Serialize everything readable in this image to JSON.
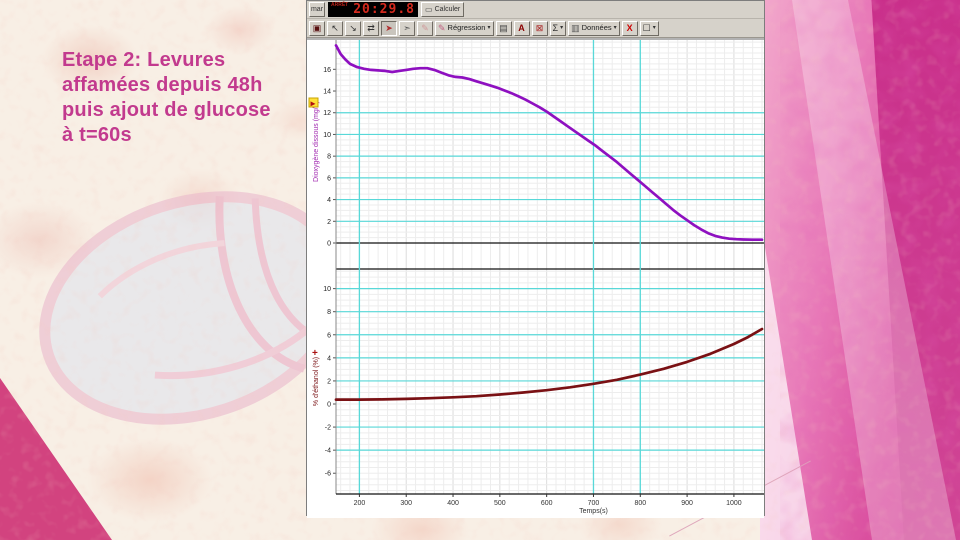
{
  "slide": {
    "title_lines": [
      "Etape 2: Levures",
      "affamées depuis 48h",
      "puis ajout de glucose",
      "à t=60s"
    ],
    "title_color": "#c23a8e"
  },
  "app": {
    "run_button_label": "mar",
    "timer": {
      "status": "ARRÊT",
      "value": "20:29.8"
    },
    "calculate_button": "Calculer",
    "icons": {
      "calculate": "▭",
      "caret": "▾"
    },
    "toolbar": [
      {
        "name": "graph-window-button",
        "glyph": "▣",
        "color": "#5a1111"
      },
      {
        "name": "cursor-zoom-in-button",
        "glyph": "↖"
      },
      {
        "name": "cursor-zoom-out-button",
        "glyph": "↘"
      },
      {
        "name": "swap-curves-button",
        "glyph": "⇄"
      },
      {
        "name": "pointer-tool-button",
        "glyph": "➤",
        "color": "#b03030",
        "pressed": true
      },
      {
        "name": "pointer-menu-button",
        "glyph": "➣",
        "color": "#555"
      },
      {
        "name": "pencil-tool-button",
        "glyph": "✎",
        "muted": true
      },
      {
        "name": "regression-button",
        "glyph": "✎",
        "color": "#c06080",
        "label": "Régression",
        "caret": true
      },
      {
        "name": "save-button",
        "glyph": "▤",
        "color": "#444"
      },
      {
        "name": "text-tool-button",
        "glyph": "A",
        "color": "#8b0000",
        "bold": true
      },
      {
        "name": "clear-curve-button",
        "glyph": "⊠",
        "color": "#aa2222"
      },
      {
        "name": "sigma-button",
        "glyph": "Σ",
        "caret": true
      },
      {
        "name": "data-button",
        "glyph": "▥",
        "color": "#555",
        "label": "Données",
        "caret": true
      },
      {
        "name": "delete-button",
        "glyph": "X",
        "color": "#cc0000",
        "bold": true
      },
      {
        "name": "selection-button",
        "glyph": "☐",
        "caret": true
      }
    ]
  },
  "colors": {
    "accent_magenta": "#c23a8e",
    "lcd_red": "#d42a1e",
    "grid_cyan": "#58d8d8",
    "grid_minor": "#ededed",
    "grid_minor_dark": "#dcdcdc",
    "o2_purple": "#8e10c0",
    "ethanol_dark_red": "#7a1114"
  },
  "chart_data": {
    "type": "line",
    "x_axis": {
      "label": "Temps(s)",
      "min": 150,
      "max": 1060,
      "ticks": [
        200,
        300,
        400,
        500,
        600,
        700,
        800,
        900,
        1000
      ],
      "cursor_lines": [
        200,
        700,
        800
      ],
      "minor_step": 20
    },
    "panels": [
      {
        "name": "dioxygene",
        "ylabel": "Dioxygène dissous (mg/L)",
        "label_color": "#a128b0",
        "color": "#8e10c0",
        "ylim": [
          0,
          18.7
        ],
        "yticks": [
          0,
          2,
          4,
          6,
          8,
          10,
          12,
          14,
          16
        ],
        "cyan_lines": [
          2,
          4,
          6,
          8,
          10,
          12
        ],
        "zero_line": 0,
        "minor_step": 0.5,
        "marker": "play",
        "series_points": [
          [
            150,
            18.2
          ],
          [
            160,
            17.4
          ],
          [
            170,
            16.9
          ],
          [
            180,
            16.5
          ],
          [
            195,
            16.2
          ],
          [
            210,
            16.05
          ],
          [
            225,
            15.95
          ],
          [
            240,
            15.9
          ],
          [
            255,
            15.85
          ],
          [
            270,
            15.75
          ],
          [
            285,
            15.85
          ],
          [
            300,
            15.95
          ],
          [
            315,
            16.05
          ],
          [
            330,
            16.1
          ],
          [
            345,
            16.1
          ],
          [
            360,
            15.95
          ],
          [
            375,
            15.7
          ],
          [
            390,
            15.45
          ],
          [
            405,
            15.3
          ],
          [
            420,
            15.25
          ],
          [
            435,
            15.1
          ],
          [
            450,
            14.9
          ],
          [
            465,
            14.7
          ],
          [
            480,
            14.5
          ],
          [
            495,
            14.3
          ],
          [
            510,
            14.05
          ],
          [
            525,
            13.8
          ],
          [
            540,
            13.5
          ],
          [
            555,
            13.2
          ],
          [
            570,
            12.85
          ],
          [
            585,
            12.5
          ],
          [
            600,
            12.1
          ],
          [
            615,
            11.65
          ],
          [
            630,
            11.2
          ],
          [
            645,
            10.75
          ],
          [
            660,
            10.3
          ],
          [
            675,
            9.85
          ],
          [
            690,
            9.4
          ],
          [
            705,
            8.95
          ],
          [
            720,
            8.45
          ],
          [
            735,
            7.95
          ],
          [
            750,
            7.45
          ],
          [
            765,
            6.9
          ],
          [
            780,
            6.35
          ],
          [
            795,
            5.8
          ],
          [
            810,
            5.25
          ],
          [
            825,
            4.7
          ],
          [
            840,
            4.15
          ],
          [
            855,
            3.6
          ],
          [
            870,
            3.05
          ],
          [
            885,
            2.55
          ],
          [
            900,
            2.1
          ],
          [
            915,
            1.65
          ],
          [
            930,
            1.25
          ],
          [
            945,
            0.9
          ],
          [
            960,
            0.65
          ],
          [
            975,
            0.5
          ],
          [
            990,
            0.4
          ],
          [
            1005,
            0.35
          ],
          [
            1020,
            0.32
          ],
          [
            1040,
            0.3
          ],
          [
            1060,
            0.3
          ]
        ]
      },
      {
        "name": "ethanol",
        "ylabel": "% d'éthanol (%)",
        "label_color": "#7a1114",
        "color": "#7a1114",
        "ylim": [
          -7.8,
          11.7
        ],
        "yticks": [
          -6,
          -4,
          -2,
          0,
          2,
          4,
          6,
          8,
          10
        ],
        "cyan_lines": [
          -4,
          -2,
          2,
          4,
          6,
          8,
          10
        ],
        "top_border": true,
        "minor_step": 0.5,
        "marker": "plus",
        "series_points": [
          [
            150,
            0.38
          ],
          [
            200,
            0.38
          ],
          [
            250,
            0.4
          ],
          [
            300,
            0.44
          ],
          [
            350,
            0.5
          ],
          [
            400,
            0.58
          ],
          [
            450,
            0.68
          ],
          [
            500,
            0.82
          ],
          [
            550,
            1.0
          ],
          [
            600,
            1.2
          ],
          [
            650,
            1.45
          ],
          [
            700,
            1.75
          ],
          [
            750,
            2.1
          ],
          [
            800,
            2.55
          ],
          [
            850,
            3.05
          ],
          [
            900,
            3.65
          ],
          [
            950,
            4.35
          ],
          [
            1000,
            5.2
          ],
          [
            1030,
            5.8
          ],
          [
            1060,
            6.5
          ]
        ]
      }
    ]
  }
}
